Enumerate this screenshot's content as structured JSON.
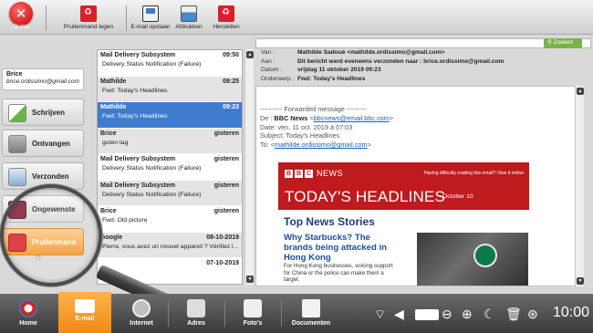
{
  "toolbar": {
    "close_label": "Sluiten",
    "empty_bin_label": "Prullenmand legen",
    "save_email_label": "E-mail opslaan",
    "print_label": "Afdrukken",
    "restore_label": "Herstellen"
  },
  "search": {
    "placeholder": "",
    "button_label": "Zoeken"
  },
  "user": {
    "name": "Brice",
    "email": "brice.ordissimo@gmail.com"
  },
  "folders": [
    {
      "label": "Schrijven"
    },
    {
      "label": "Ontvangen"
    },
    {
      "label": "Verzonden"
    },
    {
      "label": "Ongewenste"
    },
    {
      "label": "Prullenmand"
    }
  ],
  "messages": [
    {
      "from": "Mail Delivery Subsystem",
      "date": "09:50",
      "subject": "Delivery Status Notification (Failure)"
    },
    {
      "from": "Mathilde",
      "date": "09:25",
      "subject": "Fwd: Today's Headlines"
    },
    {
      "from": "Mathilde",
      "date": "09:23",
      "subject": "Fwd: Today's Headlines"
    },
    {
      "from": "Brice",
      "date": "gisteren",
      "subject": "guten tag"
    },
    {
      "from": "Mail Delivery Subsystem",
      "date": "gisteren",
      "subject": "Delivery Status Notification (Failure)"
    },
    {
      "from": "Mail Delivery Subsystem",
      "date": "gisteren",
      "subject": "Delivery Status Notification (Failure)"
    },
    {
      "from": "Brice",
      "date": "gisteren",
      "subject": "Fwd: Old picture"
    },
    {
      "from": "Google",
      "date": "08-10-2019",
      "subject": "Pierre, vous avez un nouvel appareil ? Vérifiez l..."
    },
    {
      "from": "",
      "date": "07-10-2019",
      "subject": ""
    }
  ],
  "header": {
    "van_key": "Van :",
    "van_value": "Mathilde Sadoué <mathilde.ordissimo@gmail.com>",
    "aan_key": "Aan :",
    "aan_value": "Dit bericht werd eveneens verzonden naar : brice.ordissimo@gmail.com",
    "datum_key": "Datum :",
    "datum_value": "vrijdag 11 oktober 2019 09:23",
    "onderwerp_key": "Onderwerp :",
    "onderwerp_value": "Fwd: Today's Headlines"
  },
  "body": {
    "fwd_line": "---------- Forwarded message ---------",
    "de_key": "De :",
    "de_name": "BBC News",
    "de_email": "bbcnews@email.bbc.com",
    "date_line": "Date: ven. 11 oct. 2019 à 07:03",
    "subject_line": "Subject: Today's Headlines",
    "to_key": "To:",
    "to_email": "mathilde.ordissimo@gmail.com",
    "bbc_logo_letters": [
      "B",
      "B",
      "C"
    ],
    "bbc_news": "NEWS",
    "bbc_difficulty": "Having difficulty reading this email? View it online",
    "bbc_headline": "TODAY'S HEADLINES",
    "bbc_date": "October 10",
    "top_stories": "Top News Stories",
    "story_title": "Why Starbucks? The brands being attacked in Hong Kong",
    "story_text": "For Hong Kong businesses, voicing support for China or the police can make them a target."
  },
  "bottom_nav": [
    {
      "label": "Home"
    },
    {
      "label": "E-mail"
    },
    {
      "label": "Internet"
    },
    {
      "label": "Adres"
    },
    {
      "label": "Foto's"
    },
    {
      "label": "Documenten"
    }
  ],
  "status": {
    "time": "10:00"
  }
}
